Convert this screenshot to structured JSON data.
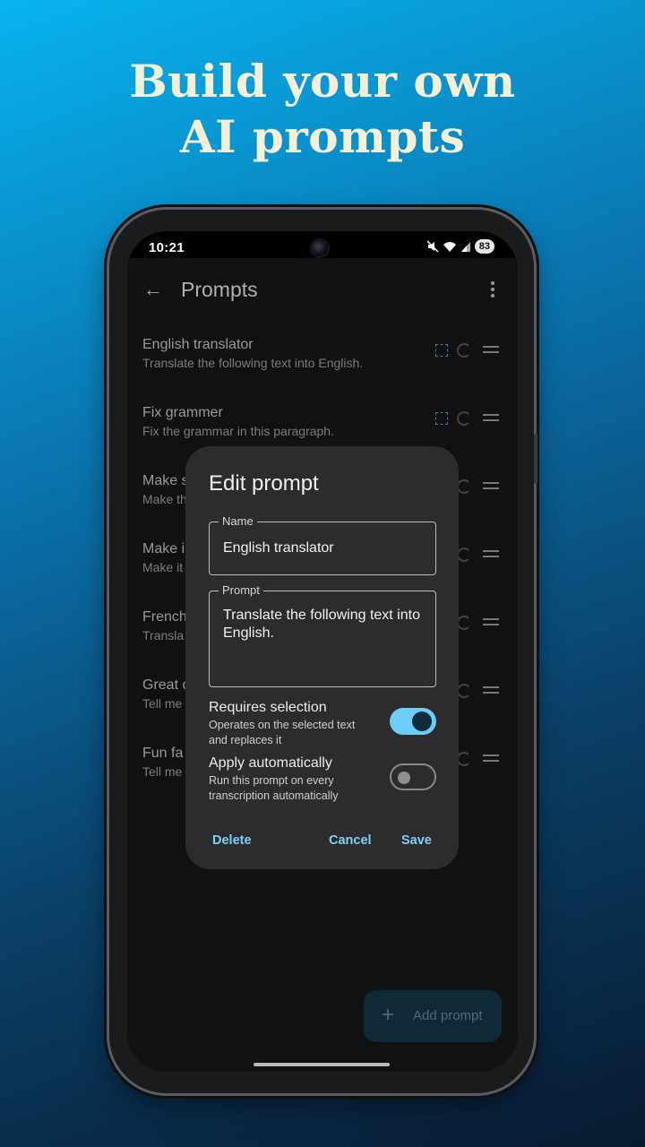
{
  "headline": {
    "line1": "Build your own",
    "line2": "AI prompts"
  },
  "status_bar": {
    "time": "10:21",
    "battery": "83"
  },
  "app": {
    "title": "Prompts",
    "prompts": [
      {
        "title": "English translator",
        "subtitle": "Translate the following text into English."
      },
      {
        "title": "Fix grammer",
        "subtitle": "Fix the grammar in this paragraph."
      },
      {
        "title": "Make s",
        "subtitle": "Make th"
      },
      {
        "title": "Make i",
        "subtitle": "Make it"
      },
      {
        "title": "French",
        "subtitle": "Transla"
      },
      {
        "title": "Great c",
        "subtitle": "Tell me"
      },
      {
        "title": "Fun fa",
        "subtitle": "Tell me"
      }
    ],
    "fab_label": "Add prompt"
  },
  "dialog": {
    "title": "Edit prompt",
    "name_label": "Name",
    "name_value": "English translator",
    "prompt_label": "Prompt",
    "prompt_value": "Translate the following text into English.",
    "requires_selection": {
      "title": "Requires selection",
      "description": "Operates on the selected text and replaces it",
      "enabled": true
    },
    "apply_automatically": {
      "title": "Apply automatically",
      "description": "Run this prompt on every transcription automatically",
      "enabled": false
    },
    "delete_label": "Delete",
    "cancel_label": "Cancel",
    "save_label": "Save"
  },
  "colors": {
    "accent": "#7fd0f6",
    "switch_on": "#6ccdf6",
    "dialog_bg": "#2c2c2f",
    "headline": "#f6f0d8"
  }
}
